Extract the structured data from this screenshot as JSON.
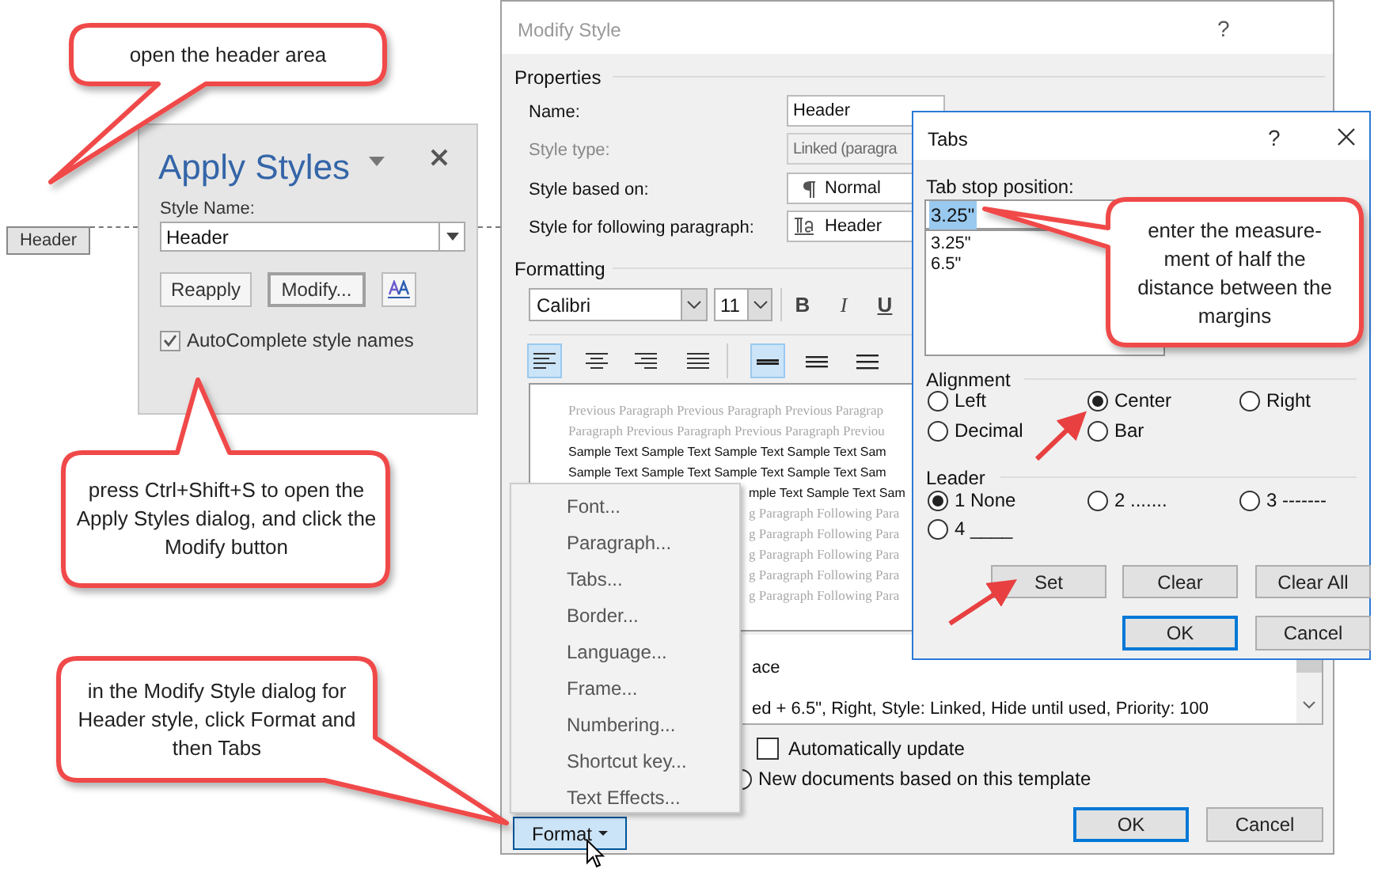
{
  "document": {
    "header_tag": "Header"
  },
  "apply_styles": {
    "title": "Apply Styles",
    "style_name_label": "Style Name:",
    "style_name": "Header",
    "buttons": [
      {
        "label": "Reapply",
        "kind": "plain"
      },
      {
        "label": "Modify...",
        "kind": "default"
      }
    ],
    "autocomplete": {
      "label": "AutoComplete style names",
      "checked": true
    }
  },
  "modify_style": {
    "title": "Modify Style",
    "help": "?",
    "properties_label": "Properties",
    "fields": [
      {
        "label": "Name:",
        "value": "Header",
        "disabled": false,
        "kind": "text"
      },
      {
        "label": "Style type:",
        "value": "Linked (paragra",
        "disabled": true,
        "kind": "text"
      },
      {
        "label": "Style based on:",
        "value": "Normal",
        "disabled": false,
        "kind": "paragraph"
      },
      {
        "label": "Style for following paragraph:",
        "value": "Header",
        "disabled": false,
        "kind": "linked"
      }
    ],
    "formatting_label": "Formatting",
    "font": "Calibri",
    "size": "11",
    "format_buttons": [
      {
        "label": "B",
        "kind": "bold"
      },
      {
        "label": "I",
        "kind": "italic"
      },
      {
        "label": "U",
        "kind": "underline"
      }
    ],
    "alignment_buttons": [
      {
        "kind": "left",
        "selected": true
      },
      {
        "kind": "center",
        "selected": false
      },
      {
        "kind": "right",
        "selected": false
      },
      {
        "kind": "justify",
        "selected": false
      },
      {
        "kind": "single",
        "selected": true
      },
      {
        "kind": "one-half",
        "selected": false
      },
      {
        "kind": "double",
        "selected": false
      }
    ],
    "preview": [
      {
        "text": "Previous Paragraph Previous Paragraph Previous Paragrap",
        "kind": "previous",
        "covered": false
      },
      {
        "text": "Paragraph Previous Paragraph Previous Paragraph Previou",
        "kind": "previous",
        "covered": false
      },
      {
        "text": "Sample Text Sample Text Sample Text Sample Text Sam",
        "kind": "sample",
        "covered": false
      },
      {
        "text": "Sample Text Sample Text Sample Text Sample Text Sam",
        "kind": "sample",
        "covered": false
      },
      {
        "text": "mple Text Sample Text Sam",
        "kind": "sample",
        "covered": true
      },
      {
        "text": "g Paragraph Following Para",
        "kind": "following",
        "covered": true
      },
      {
        "text": "g Paragraph Following Para",
        "kind": "following",
        "covered": true
      },
      {
        "text": "g Paragraph Following Para",
        "kind": "following",
        "covered": true
      },
      {
        "text": "g Paragraph Following Para",
        "kind": "following",
        "covered": true
      },
      {
        "text": "g Paragraph Following Para",
        "kind": "following",
        "covered": true
      }
    ],
    "description": [
      "ace",
      "ed +  6.5\", Right, Style: Linked, Hide until used, Priority: 100"
    ],
    "automatically_update": {
      "label": "Automatically update",
      "checked": false
    },
    "template_option": {
      "label": "New documents based on this template",
      "selected": false
    },
    "buttons": [
      {
        "label": "OK",
        "kind": "default"
      },
      {
        "label": "Cancel",
        "kind": "plain"
      }
    ],
    "format_button": {
      "label": "Format",
      "pressed": true
    }
  },
  "format_menu": [
    {
      "label": "Font..."
    },
    {
      "label": "Paragraph..."
    },
    {
      "label": "Tabs..."
    },
    {
      "label": "Border..."
    },
    {
      "label": "Language..."
    },
    {
      "label": "Frame..."
    },
    {
      "label": "Numbering..."
    },
    {
      "label": "Shortcut key..."
    },
    {
      "label": "Text Effects..."
    }
  ],
  "tabs_dialog": {
    "title": "Tabs",
    "help": "?",
    "tab_stop_label": "Tab stop position:",
    "tab_stop_value": "3.25\"",
    "tab_stops": [
      "3.25\"",
      "6.5\""
    ],
    "alignment_label": "Alignment",
    "alignment": [
      {
        "label": "Left",
        "selected": false
      },
      {
        "label": "Center",
        "selected": true
      },
      {
        "label": "Right",
        "selected": false
      },
      {
        "label": "Decimal",
        "selected": false
      },
      {
        "label": "Bar",
        "selected": false
      }
    ],
    "leader_label": "Leader",
    "leader": [
      {
        "label": "1 None",
        "selected": true
      },
      {
        "label": "2 .......",
        "selected": false
      },
      {
        "label": "3 -------",
        "selected": false
      },
      {
        "label": "4 ____",
        "selected": false
      }
    ],
    "buttons": [
      {
        "label": "Set",
        "kind": "plain"
      },
      {
        "label": "Clear",
        "kind": "plain"
      },
      {
        "label": "Clear All",
        "kind": "plain"
      },
      {
        "label": "OK",
        "kind": "default"
      },
      {
        "label": "Cancel",
        "kind": "plain"
      }
    ]
  },
  "callouts": [
    {
      "text": "open the header area"
    },
    {
      "text": "press Ctrl+Shift+S to open the Apply Styles dialog, and click the Modify button"
    },
    {
      "text": "in the Modify Style dialog for Header style, click Format and then Tabs"
    },
    {
      "text": "enter the measure-ment of half the distance between the margins"
    }
  ]
}
